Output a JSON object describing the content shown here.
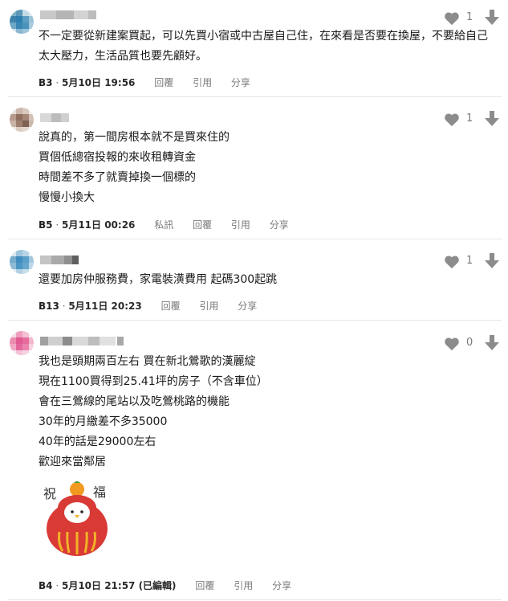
{
  "comments": [
    {
      "lines": [
        "不一定要從新建案買起，可以先買小宿或中古屋自己住，在來看是否要在換屋，不要給自己",
        "太大壓力，生活品質也要先顧好。"
      ],
      "floor": "B3",
      "date": "5月10日 19:56",
      "actions": [
        "回覆",
        "引用",
        "分享"
      ],
      "likes": "1"
    },
    {
      "lines": [
        "說真的，第一間房根本就不是買來住的",
        "買個低總宿投報的來收租轉資金",
        "時間差不多了就賣掉換一個標的",
        "慢慢小換大"
      ],
      "floor": "B5",
      "date": "5月11日 00:26",
      "actions": [
        "私訊",
        "回覆",
        "引用",
        "分享"
      ],
      "likes": "1"
    },
    {
      "lines": [
        "還要加房仲服務費，家電裝潢費用 起碼300起跳"
      ],
      "floor": "B13",
      "date": "5月11日 20:23",
      "actions": [
        "回覆",
        "引用",
        "分享"
      ],
      "likes": "1"
    },
    {
      "lines": [
        "我也是頭期兩百左右 買在新北鶯歌的漢麗綻",
        "現在1100買得到25.41坪的房子（不含車位）",
        "會在三鶯線的尾站以及吃鶯桃路的機能",
        "30年的月繳差不多35000",
        "40年的話是29000左右",
        "歡迎來當鄰居"
      ],
      "floor": "B4",
      "date": "5月10日 21:57 (已編輯)",
      "actions": [
        "回覆",
        "引用",
        "分享"
      ],
      "likes": "0"
    }
  ],
  "sticker": {
    "left_char": "祝",
    "right_char": "福"
  },
  "colors": {
    "icon": "#8c8c8c",
    "divider": "#e6e6e6",
    "meta": "#7a7a7a"
  }
}
